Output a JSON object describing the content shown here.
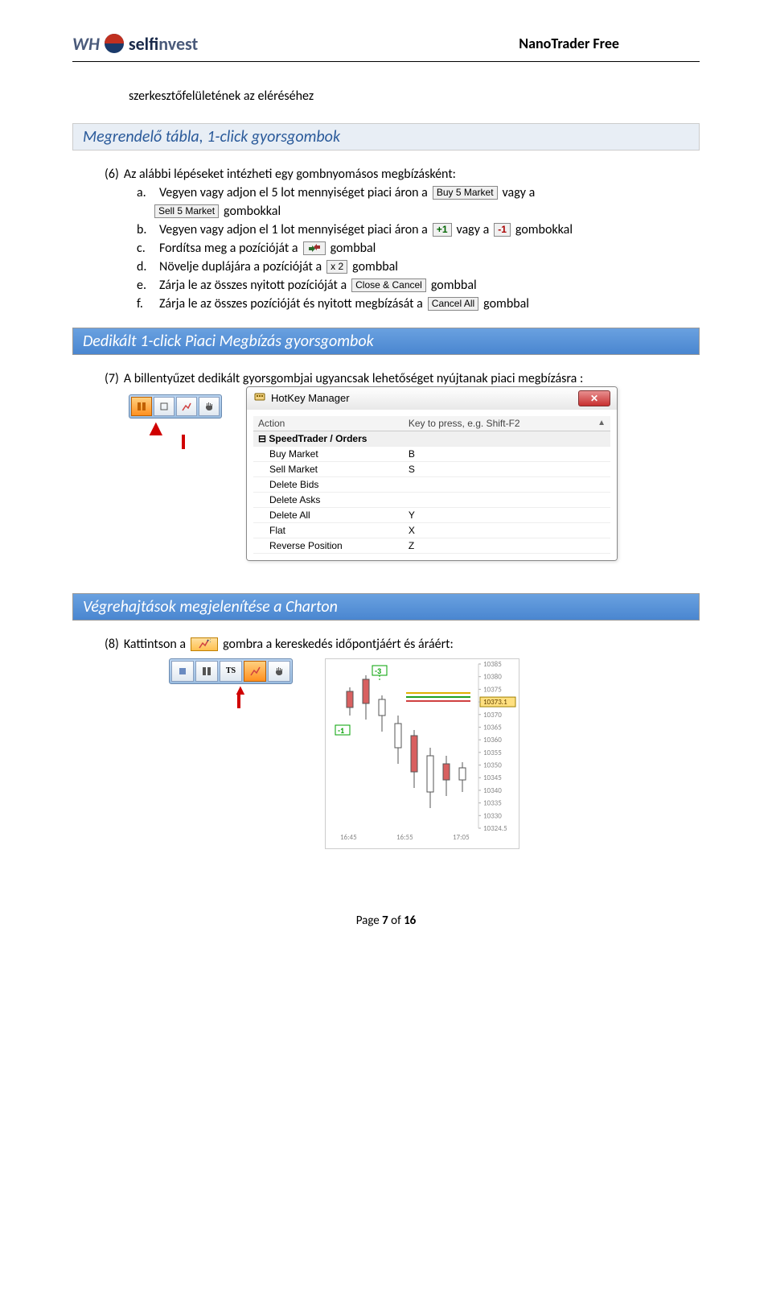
{
  "header": {
    "logo_wh": "WH",
    "logo_self": "self",
    "logo_invest": "invest",
    "doc_title": "NanoTrader Free"
  },
  "intro_line": "szerkesztőfelületének az eléréséhez",
  "section1_title": "Megrendelő tábla, 1-click gyorsgombok",
  "item6_prefix": "(6)",
  "item6_text": "Az alábbi lépéseket intézheti egy gombnyomásos megbízásként:",
  "sub": {
    "a": {
      "letter": "a.",
      "t1": "Vegyen vagy adjon el  5 lot mennyiséget piaci áron a",
      "btn1": "Buy 5 Market",
      "t2": "vagy a",
      "btn2": "Sell 5 Market",
      "t3": "gombokkal"
    },
    "b": {
      "letter": "b.",
      "t1": "Vegyen vagy adjon el  1 lot mennyiséget piaci áron a",
      "btn1": "+1",
      "t2": "vagy a",
      "btn2": "-1",
      "t3": "gombokkal"
    },
    "c": {
      "letter": "c.",
      "t1": "Fordítsa meg a pozícióját a",
      "t2": "gombbal"
    },
    "d": {
      "letter": "d.",
      "t1": "Növelje duplájára a pozícióját a",
      "btn": "x 2",
      "t2": "gombbal"
    },
    "e": {
      "letter": "e.",
      "t1": "Zárja le az összes nyitott pozícióját a",
      "btn": "Close & Cancel",
      "t2": "gombbal"
    },
    "f": {
      "letter": "f.",
      "t1": "Zárja le az összes pozícióját és nyitott megbízását a",
      "btn": "Cancel All",
      "t2": "gombbal"
    }
  },
  "section2_title": "Dedikált 1-click Piaci Megbízás gyorsgombok",
  "item7_prefix": "(7)",
  "item7_text": "A billentyűzet dedikált gyorsgombjai ugyancsak lehetőséget nyújtanak piaci megbízásra :",
  "hotkey": {
    "title": "HotKey Manager",
    "col_action": "Action",
    "col_key": "Key to press, e.g. Shift-F2",
    "group": "SpeedTrader / Orders",
    "rows": [
      {
        "action": "Buy Market",
        "key": "B"
      },
      {
        "action": "Sell Market",
        "key": "S"
      },
      {
        "action": "Delete Bids",
        "key": ""
      },
      {
        "action": "Delete Asks",
        "key": ""
      },
      {
        "action": "Delete All",
        "key": "Y"
      },
      {
        "action": "Flat",
        "key": "X"
      },
      {
        "action": "Reverse Position",
        "key": "Z"
      }
    ]
  },
  "section3_title": "Végrehajtások megjelenítése a Charton",
  "item8_prefix": "(8)",
  "item8_t1": "Kattintson a",
  "item8_t2": "gombra a kereskedés időpontjáért és áráért:",
  "chart_data": {
    "type": "candlestick",
    "yticks": [
      "10385",
      "10380",
      "10375",
      "10373.1",
      "10370",
      "10365",
      "10360",
      "10355",
      "10350",
      "10345",
      "10340",
      "10335",
      "10330",
      "10324.5"
    ],
    "xticks": [
      "16:45",
      "16:55",
      "17:05"
    ],
    "markers": [
      {
        "label": "-3",
        "color": "#00a000"
      },
      {
        "label": "-1",
        "color": "#00a000"
      }
    ],
    "highlight_price": "10373.1"
  },
  "footer": {
    "label": "Page",
    "current": "7",
    "of": "of",
    "total": "16"
  }
}
